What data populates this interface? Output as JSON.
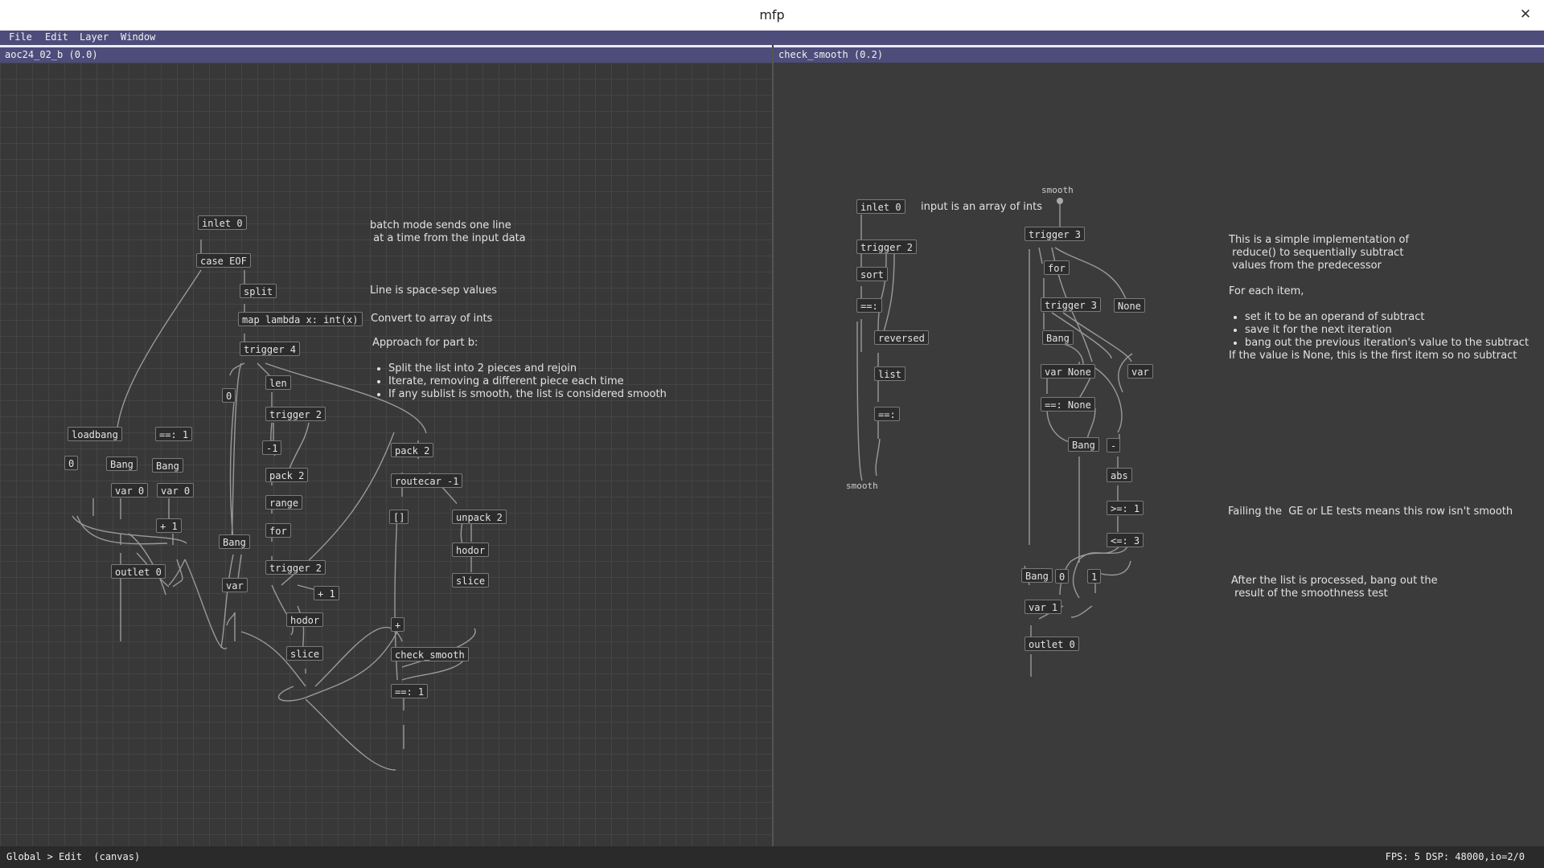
{
  "window": {
    "title": "mfp"
  },
  "menu": [
    "File",
    "Edit",
    "Layer",
    "Window"
  ],
  "left_panel": {
    "header": "aoc24_02_b (0.0)",
    "objects": {
      "inlet0": "inlet 0",
      "case_eof": "case EOF",
      "split": "split",
      "map_lambda": "map lambda x: int(x)",
      "trigger4": "trigger 4",
      "len": "len",
      "zero_msg": "0",
      "trigger2a": "trigger 2",
      "neg1": "-1",
      "pack2a": "pack 2",
      "range": "range",
      "for": "for",
      "trigger2b": "trigger 2",
      "plus1a": "+ 1",
      "hodor1": "hodor",
      "slice1": "slice",
      "bang_mid": "Bang",
      "var_mid": "var",
      "loadbang": "loadbang",
      "zero_small": "0",
      "bang_a": "Bang",
      "eq1": "==: 1",
      "bang_b": "Bang",
      "var0a": "var 0",
      "var0b": "var 0",
      "plus1b": "+ 1",
      "outlet0": "outlet 0",
      "pack2b": "pack 2",
      "routecar": "routecar -1",
      "empty_list": "[]",
      "unpack2": "unpack 2",
      "hodor2": "hodor",
      "slice2": "slice",
      "plus": "+",
      "check_smooth": "check_smooth",
      "eq1b": "==: 1"
    },
    "comments": {
      "batch_line1": "batch mode sends one line",
      "batch_line2": " at a time from the input data",
      "line_space": "Line is space-sep values",
      "convert": "Convert to array of ints",
      "approach": "Approach for part b:",
      "bullets": [
        "Split the list into 2 pieces and rejoin",
        "Iterate, removing a different piece each time",
        "If any sublist is smooth, the list is considered smooth"
      ]
    }
  },
  "right_panel": {
    "header": "check_smooth (0.2)",
    "objects": {
      "inlet0": "inlet 0",
      "trigger2": "trigger 2",
      "sort": "sort",
      "eq_a": "==:",
      "reversed": "reversed",
      "list": "list",
      "eq_b": "==:",
      "trigger3a": "trigger 3",
      "for": "for",
      "trigger3b": "trigger 3",
      "none_msg": "None",
      "bang1": "Bang",
      "var_none": "var None",
      "var": "var",
      "eq_none": "==: None",
      "bang2": "Bang",
      "minus": "-",
      "abs": "abs",
      "ge1": ">=: 1",
      "le3": "<=: 3",
      "bang3": "Bang",
      "zero": "0",
      "one": "1",
      "var1": "var 1",
      "outlet0": "outlet 0"
    },
    "labels": {
      "smooth_out": "smooth",
      "smooth_in": "smooth"
    },
    "comments": {
      "input_desc": "input is an array of ints",
      "reduce1": "This is a simple implementation of",
      "reduce2": " reduce() to sequentially subtract",
      "reduce3": " values from the predecessor",
      "for_each": "For each item,",
      "bullets": [
        "set it to be an operand of subtract",
        "save it for the next iteration",
        "bang out the previous iteration's value to the subtract"
      ],
      "none_note": "If the value is None, this is the first item so no subtract",
      "failing": "Failing the  GE or LE tests means this row isn't smooth",
      "after1": "After the list is processed, bang out the",
      "after2": " result of the smoothness test"
    }
  },
  "status": {
    "left": "Global > Edit  (canvas)",
    "right": "FPS: 5 DSP: 48000,io=2/0"
  }
}
